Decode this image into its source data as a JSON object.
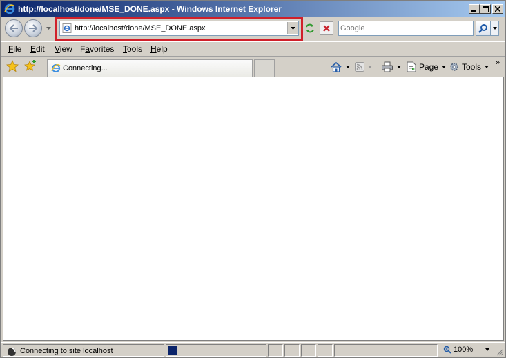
{
  "window": {
    "title": "http://localhost/done/MSE_DONE.aspx - Windows Internet Explorer"
  },
  "nav": {
    "back_label": "Back",
    "forward_label": "Forward",
    "address_url": "http://localhost/done/MSE_DONE.aspx",
    "search_placeholder": "Google",
    "highlight_color": "#d0202a"
  },
  "menu": {
    "items": [
      {
        "label_ul": "F",
        "label_rest": "ile"
      },
      {
        "label_ul": "E",
        "label_rest": "dit"
      },
      {
        "label_ul": "V",
        "label_rest": "iew"
      },
      {
        "label_ul": "",
        "label_pre": "F",
        "label_ul2": "a",
        "label_rest": "vorites"
      },
      {
        "label_ul": "T",
        "label_rest": "ools"
      },
      {
        "label_ul": "H",
        "label_rest": "elp"
      }
    ]
  },
  "tab": {
    "label": "Connecting..."
  },
  "command_bar": {
    "page_label": "Page",
    "tools_label": "Tools",
    "more_label": "»"
  },
  "status": {
    "text": "Connecting to site localhost",
    "progress_fraction": 0.1,
    "zoom_label": "100%"
  },
  "icons": {
    "ie": "ie-logo-icon",
    "back": "arrow-left-icon",
    "forward": "arrow-right-icon",
    "refresh": "refresh-icon",
    "stop": "stop-x-icon",
    "search": "magnifier-icon",
    "favorites": "star-icon",
    "add_favorite": "star-plus-icon",
    "home": "home-icon",
    "feeds": "rss-feed-icon",
    "print": "printer-icon",
    "page": "page-icon",
    "tools": "gear-icon",
    "zoom": "zoom-icon"
  }
}
